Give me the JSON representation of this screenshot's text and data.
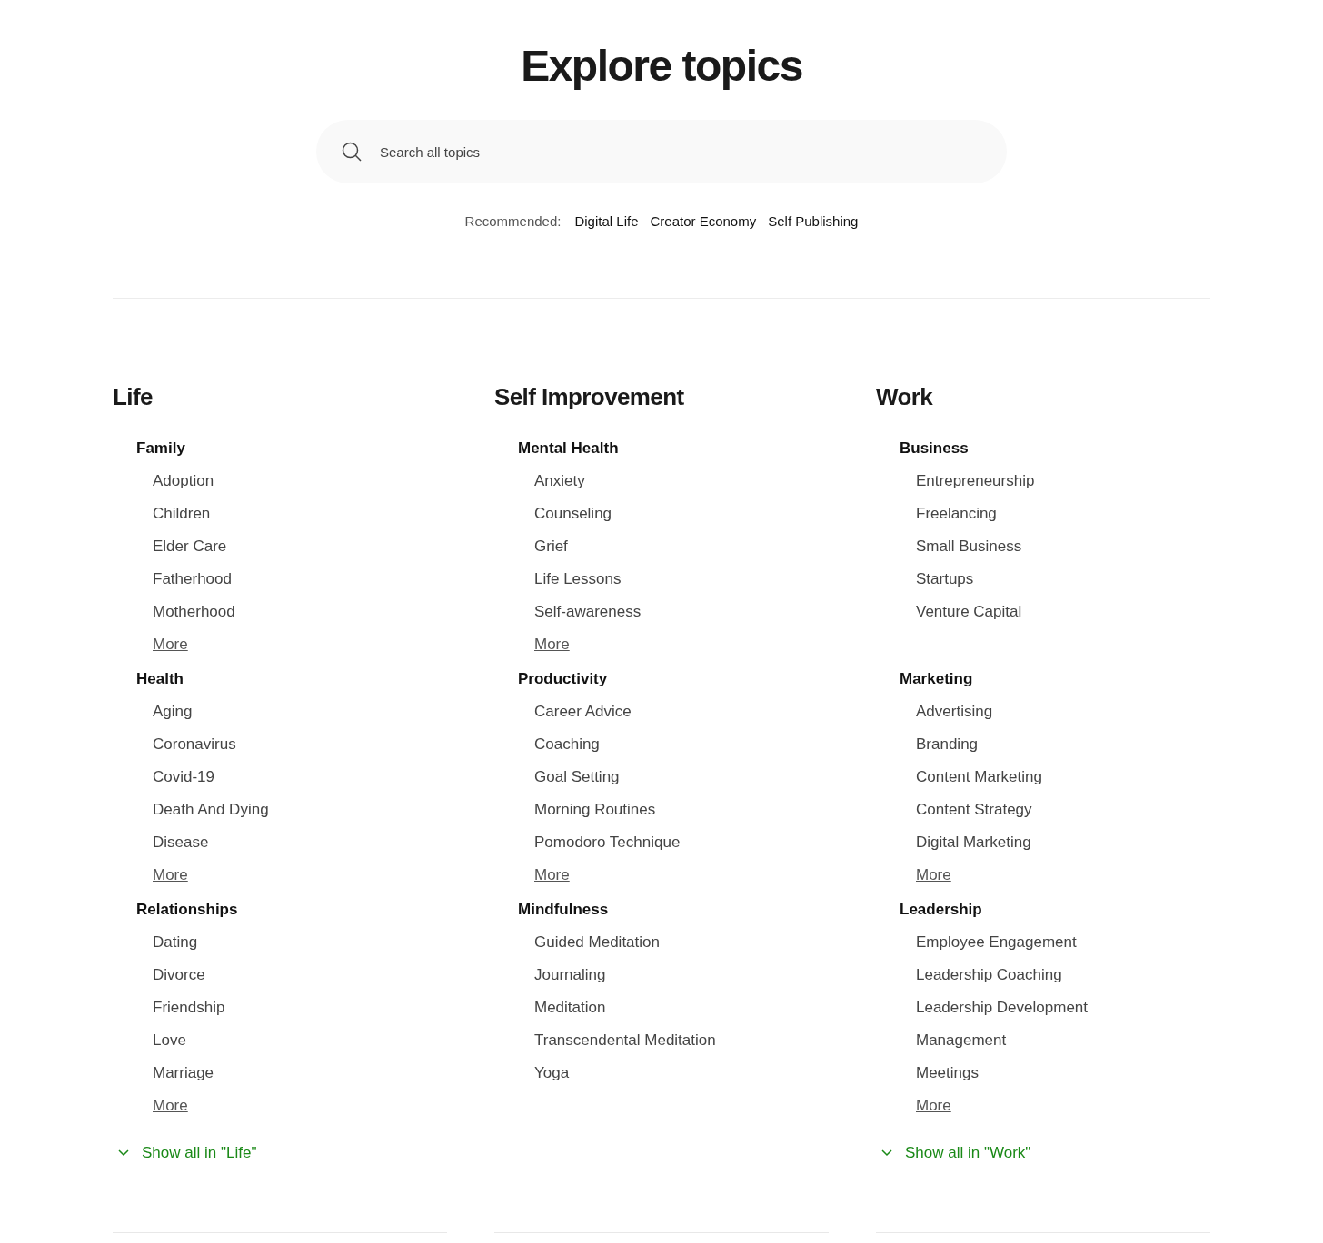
{
  "title": "Explore topics",
  "search": {
    "placeholder": "Search all topics"
  },
  "recommended": {
    "label": "Recommended:",
    "topics": [
      "Digital Life",
      "Creator Economy",
      "Self Publishing"
    ]
  },
  "columns": [
    {
      "title": "Life",
      "groups": [
        {
          "heading": "Family",
          "items": [
            "Adoption",
            "Children",
            "Elder Care",
            "Fatherhood",
            "Motherhood"
          ],
          "more": "More"
        },
        {
          "heading": "Health",
          "items": [
            "Aging",
            "Coronavirus",
            "Covid-19",
            "Death And Dying",
            "Disease"
          ],
          "more": "More"
        },
        {
          "heading": "Relationships",
          "items": [
            "Dating",
            "Divorce",
            "Friendship",
            "Love",
            "Marriage"
          ],
          "more": "More"
        }
      ],
      "show_all": "Show all in \"Life\""
    },
    {
      "title": "Self Improvement",
      "groups": [
        {
          "heading": "Mental Health",
          "items": [
            "Anxiety",
            "Counseling",
            "Grief",
            "Life Lessons",
            "Self-awareness"
          ],
          "more": "More"
        },
        {
          "heading": "Productivity",
          "items": [
            "Career Advice",
            "Coaching",
            "Goal Setting",
            "Morning Routines",
            "Pomodoro Technique"
          ],
          "more": "More"
        },
        {
          "heading": "Mindfulness",
          "items": [
            "Guided Meditation",
            "Journaling",
            "Meditation",
            "Transcendental Meditation",
            "Yoga"
          ]
        }
      ]
    },
    {
      "title": "Work",
      "groups": [
        {
          "heading": "Business",
          "items": [
            "Entrepreneurship",
            "Freelancing",
            "Small Business",
            "Startups",
            "Venture Capital"
          ]
        },
        {
          "heading": "Marketing",
          "items": [
            "Advertising",
            "Branding",
            "Content Marketing",
            "Content Strategy",
            "Digital Marketing"
          ],
          "more": "More"
        },
        {
          "heading": "Leadership",
          "items": [
            "Employee Engagement",
            "Leadership Coaching",
            "Leadership Development",
            "Management",
            "Meetings"
          ],
          "more": "More"
        }
      ],
      "show_all": "Show all in \"Work\""
    }
  ]
}
